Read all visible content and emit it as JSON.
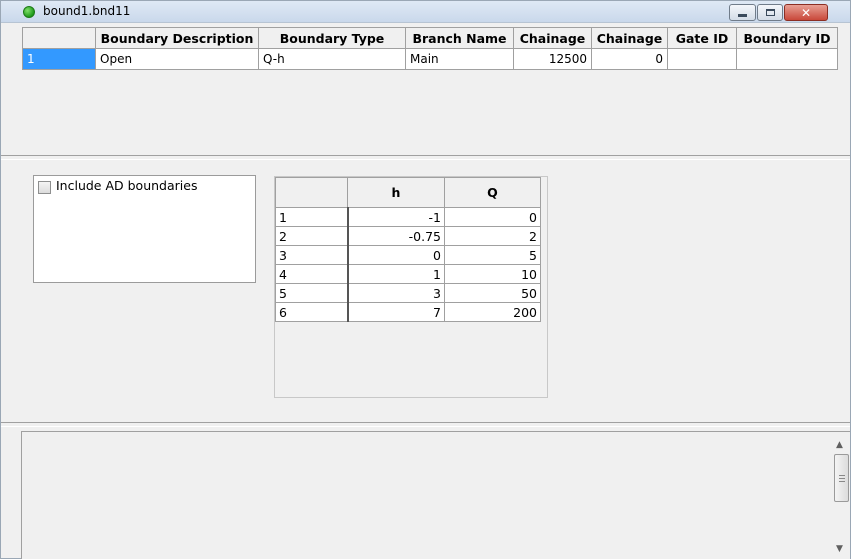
{
  "window": {
    "title": "bound1.bnd11"
  },
  "boundaries_table": {
    "headers": [
      "Boundary Description",
      "Boundary Type",
      "Branch Name",
      "Chainage",
      "Chainage",
      "Gate ID",
      "Boundary ID"
    ],
    "rows": [
      {
        "row_num": "1",
        "description": "Open",
        "type": "Q-h",
        "branch": "Main",
        "chainage1": "12500",
        "chainage2": "0",
        "gate_id": "",
        "boundary_id": ""
      }
    ]
  },
  "ad_option": {
    "label": "Include AD boundaries",
    "checked": false
  },
  "qh_table": {
    "headers": [
      "h",
      "Q"
    ],
    "rows": [
      {
        "n": "1",
        "h": "-1",
        "q": "0"
      },
      {
        "n": "2",
        "h": "-0.75",
        "q": "2"
      },
      {
        "n": "3",
        "h": "0",
        "q": "5"
      },
      {
        "n": "4",
        "h": "1",
        "q": "10"
      },
      {
        "n": "5",
        "h": "3",
        "q": "50"
      },
      {
        "n": "6",
        "h": "7",
        "q": "200"
      }
    ]
  },
  "colors": {
    "selection": "#3399ff",
    "close_button": "#c9483a",
    "status_icon": "#1f9a1a"
  }
}
